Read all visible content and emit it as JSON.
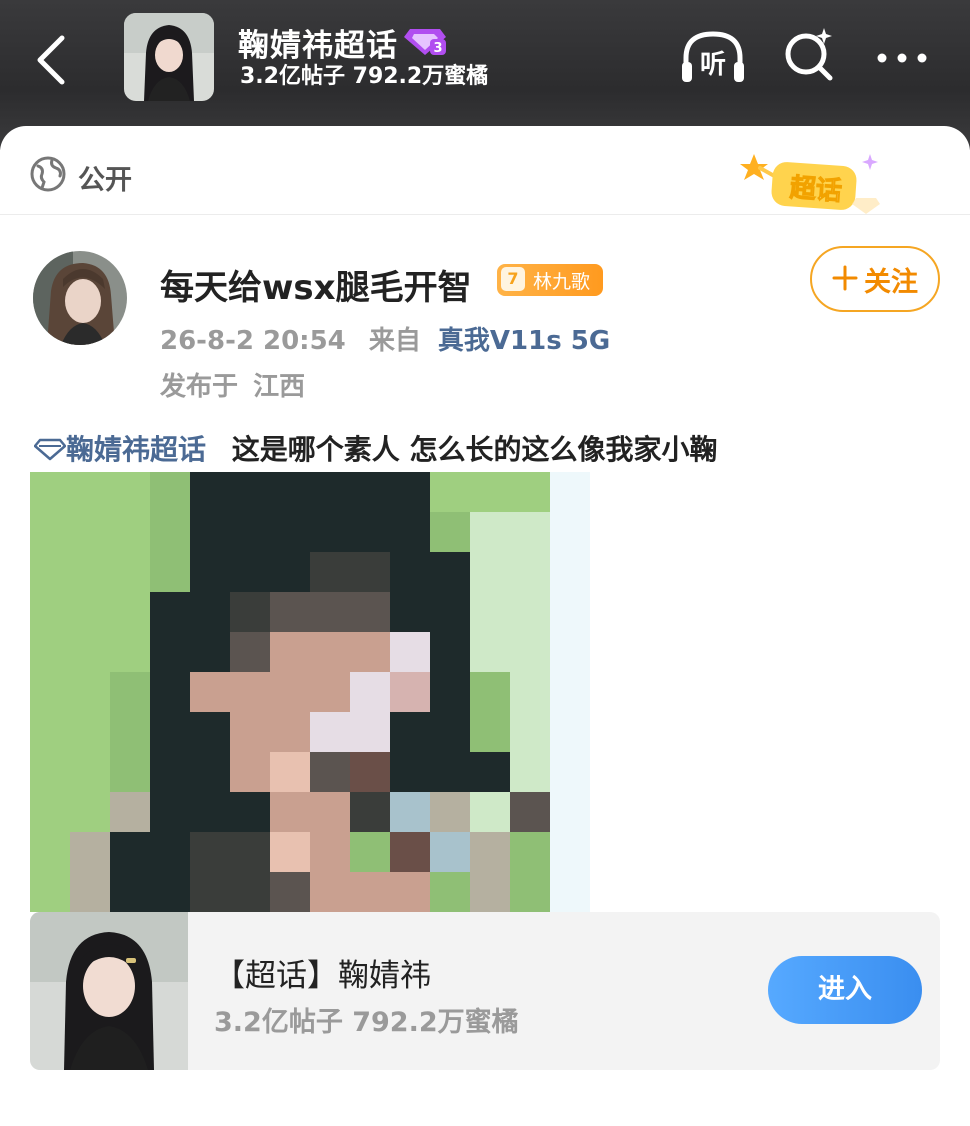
{
  "header": {
    "title": "鞠婧祎超话",
    "level_badge_number": "3",
    "stats": "3.2亿帖子 792.2万蜜橘",
    "listen_label": "听",
    "icons": {
      "back": "chevron-left-icon",
      "listen": "headphones-icon",
      "search": "search-sparkle-icon",
      "more": "more-dots-icon"
    }
  },
  "post": {
    "visibility": "公开",
    "sticker_label": "超话",
    "author": {
      "name": "每天给wsx腿毛开智",
      "fan_badge_level": "7",
      "fan_badge_name": "林九歌",
      "follow_label": "关注"
    },
    "time": "26-8-2 20:54",
    "from_label": "来自",
    "device": "真我V11s 5G",
    "location_label": "发布于",
    "location": "江西",
    "topic_link": "鞠婧祎超话",
    "body": "这是哪个素人 怎么长的这么像我家小鞠"
  },
  "topic_card": {
    "title": "【超话】鞠婧祎",
    "stats": "3.2亿帖子 792.2万蜜橘",
    "enter_label": "进入"
  },
  "colors": {
    "accent_orange": "#f28a00",
    "link_blue": "#4b6a94",
    "enter_blue": "#3a8ef0",
    "header_dark": "#2c2c2e"
  }
}
